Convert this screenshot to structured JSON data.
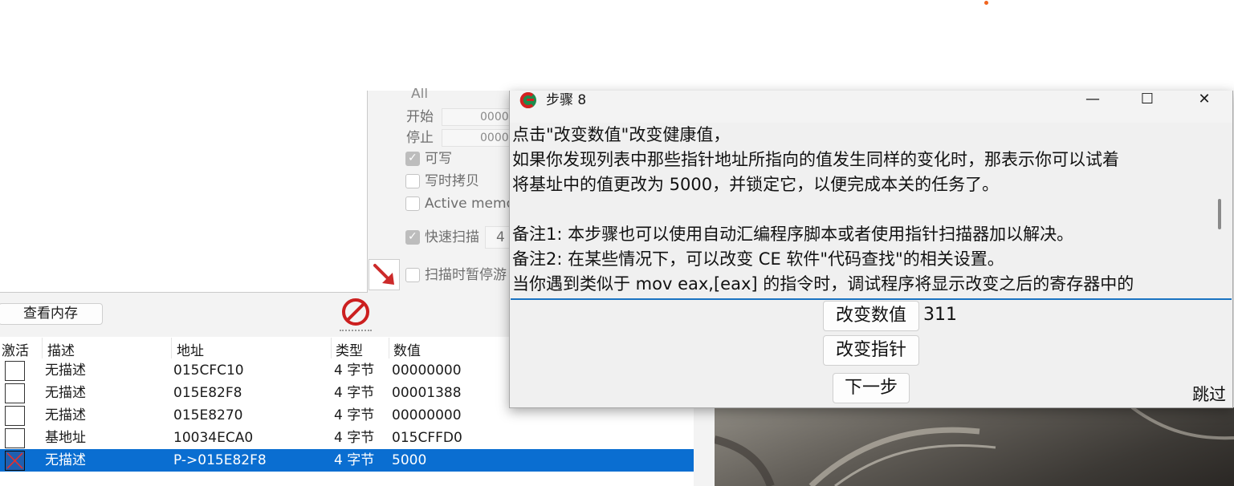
{
  "main_window": {
    "scan_options": {
      "memory_type_partial": "All",
      "start_label": "开始",
      "start_value": "0000",
      "stop_label": "停止",
      "stop_value": "0000",
      "writable_label": "可写",
      "copy_on_write_label": "写时拷贝",
      "active_memory_label": "Active memo",
      "fast_scan_label": "快速扫描",
      "fast_scan_value": "4",
      "pause_game_label": "扫描时暂停游"
    },
    "memory_view_button": "查看内存",
    "address_list": {
      "columns": [
        "激活",
        "描述",
        "地址",
        "类型",
        "数值"
      ],
      "rows": [
        {
          "active": false,
          "description": "无描述",
          "address": "015CFC10",
          "type": "4 字节",
          "value": "00000000",
          "selected": false
        },
        {
          "active": false,
          "description": "无描述",
          "address": "015E82F8",
          "type": "4 字节",
          "value": "00001388",
          "selected": false
        },
        {
          "active": false,
          "description": "无描述",
          "address": "015E8270",
          "type": "4 字节",
          "value": "00000000",
          "selected": false
        },
        {
          "active": false,
          "description": "基地址",
          "address": "10034ECA0",
          "type": "4 字节",
          "value": "015CFFD0",
          "selected": false
        },
        {
          "active": true,
          "description": "无描述",
          "address": "P->015E82F8",
          "type": "4 字节",
          "value": "5000",
          "selected": true
        }
      ]
    }
  },
  "dialog": {
    "title": "步骤 8",
    "window_controls": {
      "minimize": "—",
      "maximize": "☐",
      "close": "✕"
    },
    "lines": [
      "点击\"改变数值\"改变健康值，",
      "如果你发现列表中那些指针地址所指向的值发生同样的变化时，那表示你可以试着",
      "将基址中的值更改为 5000，并锁定它，以便完成本关的任务了。",
      "",
      "备注1: 本步骤也可以使用自动汇编程序脚本或者使用指针扫描器加以解决。",
      "备注2: 在某些情况下，可以改变 CE 软件\"代码查找\"的相关设置。",
      "当你遇到类似于 mov eax,[eax] 的指令时，调试程序将显示改变之后的寄存器中的"
    ],
    "change_value_button": "改变数值",
    "current_value": "311",
    "change_pointer_button": "改变指针",
    "next_button": "下一步",
    "skip_label": "跳过"
  },
  "colors": {
    "selection": "#0a6ed1",
    "accent_line": "#1a73c2",
    "stop_icon": "#cc1f1f",
    "arrow_icon": "#cc2a2a",
    "orange_dot": "#f0641e"
  }
}
